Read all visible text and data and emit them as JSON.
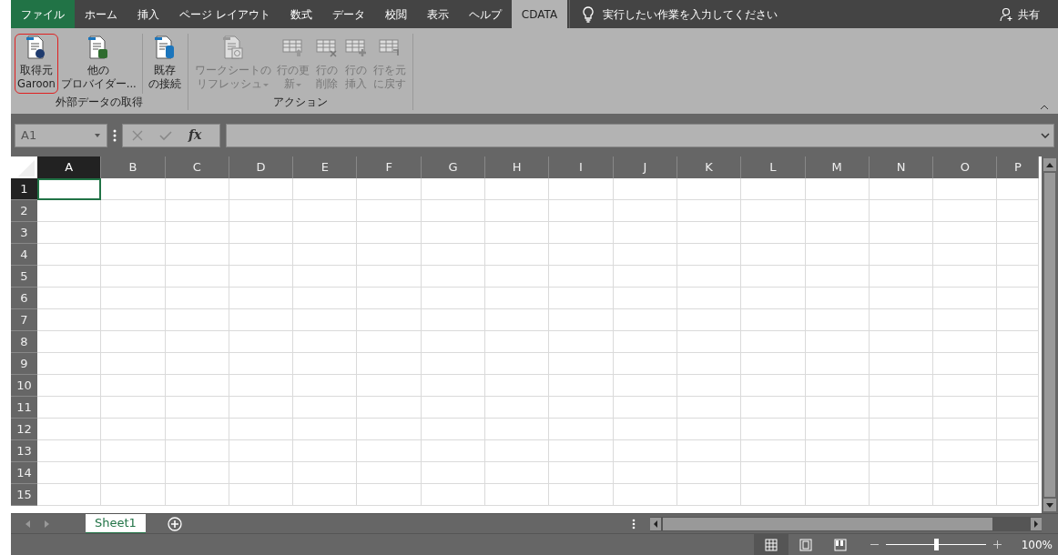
{
  "tabs": [
    {
      "label": "ファイル",
      "kind": "file",
      "selected": false
    },
    {
      "label": "ホーム",
      "kind": "tab",
      "selected": false
    },
    {
      "label": "挿入",
      "kind": "tab",
      "selected": false
    },
    {
      "label": "ページ レイアウト",
      "kind": "tab",
      "selected": false
    },
    {
      "label": "数式",
      "kind": "tab",
      "selected": false
    },
    {
      "label": "データ",
      "kind": "tab",
      "selected": false
    },
    {
      "label": "校閲",
      "kind": "tab",
      "selected": false
    },
    {
      "label": "表示",
      "kind": "tab",
      "selected": false
    },
    {
      "label": "ヘルプ",
      "kind": "tab",
      "selected": false
    },
    {
      "label": "CDATA",
      "kind": "tab",
      "selected": true
    }
  ],
  "tell_me": {
    "placeholder": "実行したい作業を入力してください"
  },
  "share": "共有",
  "ribbon_groups": [
    {
      "label": "外部データの取得",
      "sections": [
        [
          {
            "lines": [
              "取得元",
              "Garoon"
            ],
            "kind": "globe",
            "disabled": false,
            "dropdown": false,
            "highlighted": true
          },
          {
            "lines": [
              "他の",
              "プロバイダー..."
            ],
            "kind": "database",
            "disabled": false,
            "dropdown": false,
            "highlighted": false
          }
        ],
        [
          {
            "lines": [
              "既存",
              "の接続"
            ],
            "kind": "cylinder",
            "disabled": false,
            "dropdown": false,
            "highlighted": false
          }
        ]
      ]
    },
    {
      "label": "アクション",
      "sections": [
        [
          {
            "lines": [
              "ワークシートの",
              "リフレッシュ"
            ],
            "kind": "refresh",
            "disabled": true,
            "dropdown": true,
            "highlighted": false
          },
          {
            "lines": [
              "行の更",
              "新"
            ],
            "kind": "update",
            "disabled": true,
            "dropdown": true,
            "highlighted": false
          },
          {
            "lines": [
              "行の",
              "削除"
            ],
            "kind": "delete",
            "disabled": true,
            "dropdown": false,
            "highlighted": false
          },
          {
            "lines": [
              "行の",
              "挿入"
            ],
            "kind": "insert",
            "disabled": true,
            "dropdown": false,
            "highlighted": false
          },
          {
            "lines": [
              "行を元",
              "に戻す"
            ],
            "kind": "undo",
            "disabled": true,
            "dropdown": false,
            "highlighted": false
          }
        ]
      ]
    }
  ],
  "name_box": "A1",
  "fx": "fx",
  "columns": [
    {
      "label": "A",
      "selected": true
    },
    {
      "label": "B",
      "selected": false
    },
    {
      "label": "C",
      "selected": false
    },
    {
      "label": "D",
      "selected": false
    },
    {
      "label": "E",
      "selected": false
    },
    {
      "label": "F",
      "selected": false
    },
    {
      "label": "G",
      "selected": false
    },
    {
      "label": "H",
      "selected": false
    },
    {
      "label": "I",
      "selected": false
    },
    {
      "label": "J",
      "selected": false
    },
    {
      "label": "K",
      "selected": false
    },
    {
      "label": "L",
      "selected": false
    },
    {
      "label": "M",
      "selected": false
    },
    {
      "label": "N",
      "selected": false
    },
    {
      "label": "O",
      "selected": false
    },
    {
      "label": "P",
      "selected": false
    }
  ],
  "rows": [
    {
      "label": "1",
      "selected": true
    },
    {
      "label": "2",
      "selected": false
    },
    {
      "label": "3",
      "selected": false
    },
    {
      "label": "4",
      "selected": false
    },
    {
      "label": "5",
      "selected": false
    },
    {
      "label": "6",
      "selected": false
    },
    {
      "label": "7",
      "selected": false
    },
    {
      "label": "8",
      "selected": false
    },
    {
      "label": "9",
      "selected": false
    },
    {
      "label": "10",
      "selected": false
    },
    {
      "label": "11",
      "selected": false
    },
    {
      "label": "12",
      "selected": false
    },
    {
      "label": "13",
      "selected": false
    },
    {
      "label": "14",
      "selected": false
    },
    {
      "label": "15",
      "selected": false
    }
  ],
  "sheet_tabs": [
    {
      "label": "Sheet1",
      "selected": true
    }
  ],
  "status_bar": {
    "views": [
      {
        "kind": "normal",
        "selected": true
      },
      {
        "kind": "page-layout",
        "selected": false
      },
      {
        "kind": "page-break",
        "selected": false
      }
    ],
    "zoom": {
      "level": 0.5
    },
    "zoom_reading": "100%"
  }
}
